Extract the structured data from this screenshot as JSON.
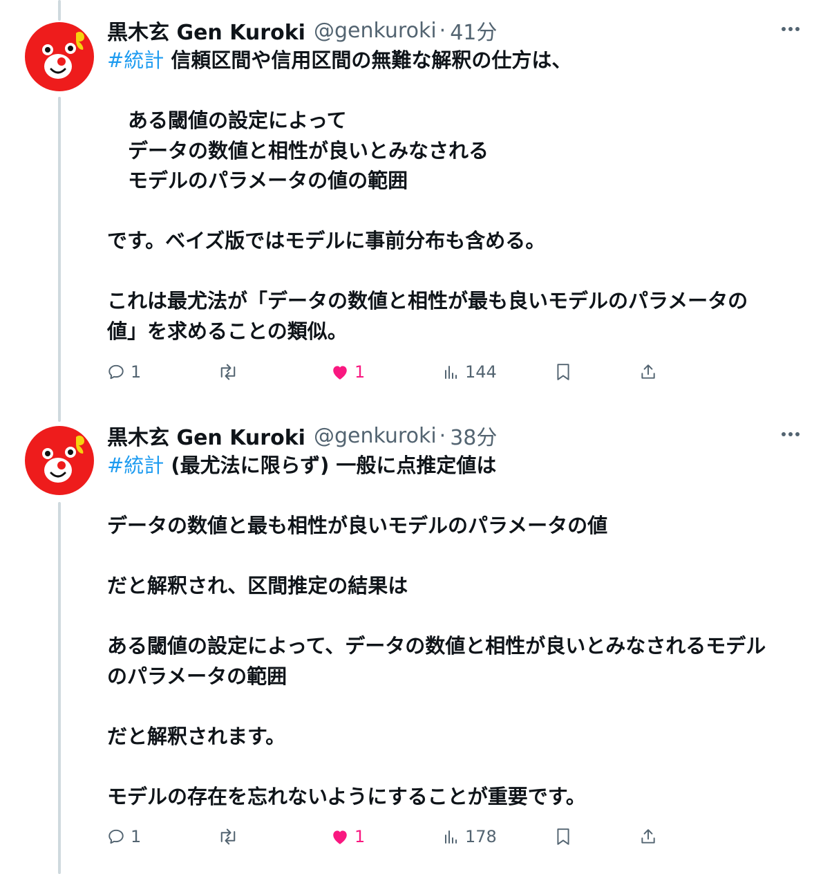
{
  "tweets": [
    {
      "display_name": "黒木玄 Gen Kuroki",
      "handle": "@genkuroki",
      "dot": "·",
      "time": "41分",
      "hashtag": "#統計",
      "line_first": " 信頼区間や信用区間の無難な解釈の仕方は、",
      "indented_lines": [
        "ある閾値の設定によって",
        "データの数値と相性が良いとみなされる",
        "モデルのパラメータの値の範囲"
      ],
      "line_after": "です。ベイズ版ではモデルに事前分布も含める。",
      "closing_lines": [
        "これは最尤法が「データの数値と相性が最も良いモデルのパラメータの",
        "値」を求めることの類似。"
      ],
      "reply_count": "1",
      "like_count": "1",
      "view_count": "144"
    },
    {
      "display_name": "黒木玄 Gen Kuroki",
      "handle": "@genkuroki",
      "dot": "·",
      "time": "38分",
      "hashtag": "#統計",
      "line_first": " (最尤法に限らず) 一般に点推定値は",
      "lines": [
        "データの数値と最も相性が良いモデルのパラメータの値",
        "だと解釈され、区間推定の結果は",
        "ある閾値の設定によって、データの数値と相性が良いとみなされるモデル",
        "のパラメータの範囲",
        "だと解釈されます。",
        "モデルの存在を忘れないようにすることが重要です。"
      ],
      "reply_count": "1",
      "like_count": "1",
      "view_count": "178"
    }
  ],
  "colors": {
    "hashtag": "#1d9bf0",
    "muted": "#536471",
    "like": "#f91880",
    "avatar_bg": "#ee1c1c",
    "thread_line": "#cfd9de"
  },
  "icons": {
    "reply": "reply-icon",
    "retweet": "retweet-icon",
    "like": "heart-icon",
    "views": "views-icon",
    "bookmark": "bookmark-icon",
    "share": "share-icon",
    "more": "more-icon"
  }
}
